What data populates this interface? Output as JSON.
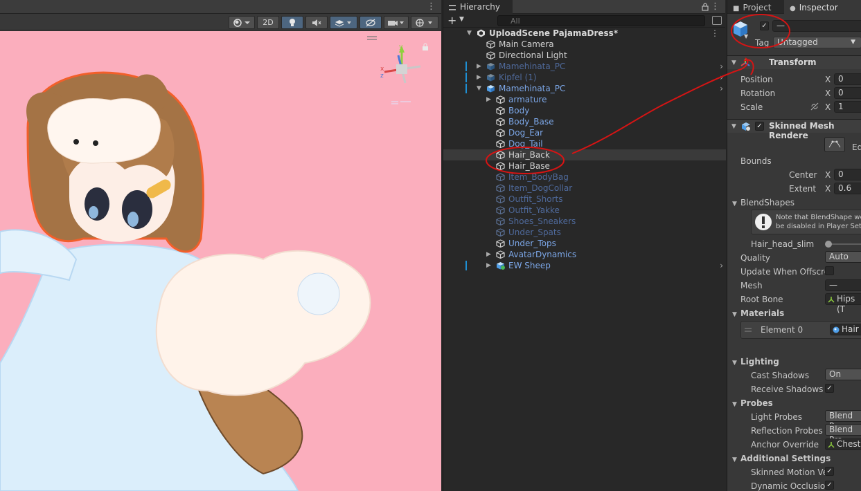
{
  "scene": {
    "btn_2d": "2D",
    "gizmo_y": "y",
    "gizmo_x": "x",
    "gizmo_z": "z"
  },
  "hierarchy": {
    "tab_label": "Hierarchy",
    "search_placeholder": "All",
    "rows": [
      {
        "label": "UploadScene PajamaDress*",
        "style": "root",
        "indent": 0,
        "arrow": "▼",
        "icon": "unity",
        "more": "⋮"
      },
      {
        "label": "Main Camera",
        "style": "normal",
        "indent": 1,
        "icon": "cube"
      },
      {
        "label": "Directional Light",
        "style": "normal",
        "indent": 1,
        "icon": "cube"
      },
      {
        "label": "Mamehinata_PC",
        "style": "prefab-dim",
        "indent": 1,
        "arrow": "▶",
        "icon": "prefab",
        "mark": true,
        "right": "›"
      },
      {
        "label": "Kipfel (1)",
        "style": "prefab-dim",
        "indent": 1,
        "arrow": "▶",
        "icon": "prefab",
        "mark": true,
        "right": "›"
      },
      {
        "label": "Mamehinata_PC",
        "style": "prefab",
        "indent": 1,
        "arrow": "▼",
        "icon": "prefab",
        "mark": true,
        "right": "›"
      },
      {
        "label": "armature",
        "style": "prefab",
        "indent": 2,
        "arrow": "▶",
        "icon": "cube"
      },
      {
        "label": "Body",
        "style": "prefab",
        "indent": 2,
        "icon": "cube"
      },
      {
        "label": "Body_Base",
        "style": "prefab",
        "indent": 2,
        "icon": "cube"
      },
      {
        "label": "Dog_Ear",
        "style": "prefab",
        "indent": 2,
        "icon": "cube"
      },
      {
        "label": "Dog_Tail",
        "style": "prefab",
        "indent": 2,
        "icon": "cube"
      },
      {
        "label": "Hair_Back",
        "style": "normal",
        "indent": 2,
        "icon": "cube",
        "selected": true
      },
      {
        "label": "Hair_Base",
        "style": "normal",
        "indent": 2,
        "icon": "cube"
      },
      {
        "label": "Item_BodyBag",
        "style": "prefab-dim",
        "indent": 2,
        "icon": "cube-dim"
      },
      {
        "label": "Item_DogCollar",
        "style": "prefab-dim",
        "indent": 2,
        "icon": "cube-dim"
      },
      {
        "label": "Outfit_Shorts",
        "style": "prefab-dim",
        "indent": 2,
        "icon": "cube-dim"
      },
      {
        "label": "Outfit_Yakke",
        "style": "prefab-dim",
        "indent": 2,
        "icon": "cube-dim"
      },
      {
        "label": "Shoes_Sneakers",
        "style": "prefab-dim",
        "indent": 2,
        "icon": "cube-dim"
      },
      {
        "label": "Under_Spats",
        "style": "prefab-dim",
        "indent": 2,
        "icon": "cube-dim"
      },
      {
        "label": "Under_Tops",
        "style": "prefab",
        "indent": 2,
        "icon": "cube"
      },
      {
        "label": "AvatarDynamics",
        "style": "prefab",
        "indent": 2,
        "arrow": "▶",
        "icon": "cube"
      },
      {
        "label": "EW Sheep",
        "style": "prefab",
        "indent": 2,
        "arrow": "▶",
        "icon": "prefab-green",
        "mark": true,
        "right": "›"
      }
    ]
  },
  "inspector": {
    "tab_project": "Project",
    "tab_inspector": "Inspector",
    "name_value": "—",
    "tag_label": "Tag",
    "tag_value": "Untagged",
    "transform_title": "Transform",
    "position_label": "Position",
    "position_x": "0",
    "rotation_label": "Rotation",
    "rotation_x": "0",
    "scale_label": "Scale",
    "scale_x": "1",
    "axis_x": "X",
    "smr_title": "Skinned Mesh Rendere",
    "edit_label": "Ed",
    "bounds_label": "Bounds",
    "center_label": "Center",
    "center_x": "0",
    "extent_label": "Extent",
    "extent_x": "0.6",
    "blendshapes_label": "BlendShapes",
    "note_line1": "Note that BlendShape we",
    "note_line2": "be disabled in Player Setti",
    "blend_item": "Hair_head_slim",
    "blend_value": 0,
    "quality_label": "Quality",
    "quality_value": "Auto",
    "update_offscreen_label": "Update When Offscre",
    "mesh_label": "Mesh",
    "mesh_value": "—",
    "root_bone_label": "Root Bone",
    "root_bone_value": "Hips (T",
    "materials_label": "Materials",
    "element0_label": "Element 0",
    "element0_value": "Hair",
    "lighting_label": "Lighting",
    "cast_shadows_label": "Cast Shadows",
    "cast_shadows_value": "On",
    "receive_shadows_label": "Receive Shadows",
    "probes_label": "Probes",
    "light_probes_label": "Light Probes",
    "light_probes_value": "Blend Pro",
    "reflection_probes_label": "Reflection Probes",
    "reflection_probes_value": "Blend Pro",
    "anchor_override_label": "Anchor Override",
    "anchor_override_value": "Chest",
    "additional_label": "Additional Settings",
    "skinned_motion_label": "Skinned Motion Ve",
    "dynamic_occlusion_label": "Dynamic Occlusion",
    "check": "✓"
  }
}
